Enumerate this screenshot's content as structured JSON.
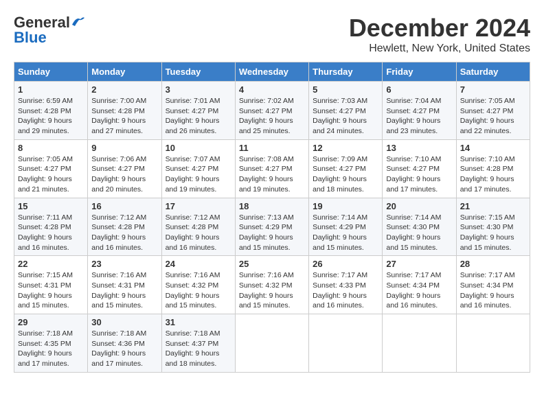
{
  "header": {
    "logo_general": "General",
    "logo_blue": "Blue",
    "month_title": "December 2024",
    "location": "Hewlett, New York, United States"
  },
  "weekdays": [
    "Sunday",
    "Monday",
    "Tuesday",
    "Wednesday",
    "Thursday",
    "Friday",
    "Saturday"
  ],
  "weeks": [
    [
      {
        "day": "1",
        "sunrise": "6:59 AM",
        "sunset": "4:28 PM",
        "daylight": "9 hours and 29 minutes."
      },
      {
        "day": "2",
        "sunrise": "7:00 AM",
        "sunset": "4:28 PM",
        "daylight": "9 hours and 27 minutes."
      },
      {
        "day": "3",
        "sunrise": "7:01 AM",
        "sunset": "4:27 PM",
        "daylight": "9 hours and 26 minutes."
      },
      {
        "day": "4",
        "sunrise": "7:02 AM",
        "sunset": "4:27 PM",
        "daylight": "9 hours and 25 minutes."
      },
      {
        "day": "5",
        "sunrise": "7:03 AM",
        "sunset": "4:27 PM",
        "daylight": "9 hours and 24 minutes."
      },
      {
        "day": "6",
        "sunrise": "7:04 AM",
        "sunset": "4:27 PM",
        "daylight": "9 hours and 23 minutes."
      },
      {
        "day": "7",
        "sunrise": "7:05 AM",
        "sunset": "4:27 PM",
        "daylight": "9 hours and 22 minutes."
      }
    ],
    [
      {
        "day": "8",
        "sunrise": "7:05 AM",
        "sunset": "4:27 PM",
        "daylight": "9 hours and 21 minutes."
      },
      {
        "day": "9",
        "sunrise": "7:06 AM",
        "sunset": "4:27 PM",
        "daylight": "9 hours and 20 minutes."
      },
      {
        "day": "10",
        "sunrise": "7:07 AM",
        "sunset": "4:27 PM",
        "daylight": "9 hours and 19 minutes."
      },
      {
        "day": "11",
        "sunrise": "7:08 AM",
        "sunset": "4:27 PM",
        "daylight": "9 hours and 19 minutes."
      },
      {
        "day": "12",
        "sunrise": "7:09 AM",
        "sunset": "4:27 PM",
        "daylight": "9 hours and 18 minutes."
      },
      {
        "day": "13",
        "sunrise": "7:10 AM",
        "sunset": "4:27 PM",
        "daylight": "9 hours and 17 minutes."
      },
      {
        "day": "14",
        "sunrise": "7:10 AM",
        "sunset": "4:28 PM",
        "daylight": "9 hours and 17 minutes."
      }
    ],
    [
      {
        "day": "15",
        "sunrise": "7:11 AM",
        "sunset": "4:28 PM",
        "daylight": "9 hours and 16 minutes."
      },
      {
        "day": "16",
        "sunrise": "7:12 AM",
        "sunset": "4:28 PM",
        "daylight": "9 hours and 16 minutes."
      },
      {
        "day": "17",
        "sunrise": "7:12 AM",
        "sunset": "4:28 PM",
        "daylight": "9 hours and 16 minutes."
      },
      {
        "day": "18",
        "sunrise": "7:13 AM",
        "sunset": "4:29 PM",
        "daylight": "9 hours and 15 minutes."
      },
      {
        "day": "19",
        "sunrise": "7:14 AM",
        "sunset": "4:29 PM",
        "daylight": "9 hours and 15 minutes."
      },
      {
        "day": "20",
        "sunrise": "7:14 AM",
        "sunset": "4:30 PM",
        "daylight": "9 hours and 15 minutes."
      },
      {
        "day": "21",
        "sunrise": "7:15 AM",
        "sunset": "4:30 PM",
        "daylight": "9 hours and 15 minutes."
      }
    ],
    [
      {
        "day": "22",
        "sunrise": "7:15 AM",
        "sunset": "4:31 PM",
        "daylight": "9 hours and 15 minutes."
      },
      {
        "day": "23",
        "sunrise": "7:16 AM",
        "sunset": "4:31 PM",
        "daylight": "9 hours and 15 minutes."
      },
      {
        "day": "24",
        "sunrise": "7:16 AM",
        "sunset": "4:32 PM",
        "daylight": "9 hours and 15 minutes."
      },
      {
        "day": "25",
        "sunrise": "7:16 AM",
        "sunset": "4:32 PM",
        "daylight": "9 hours and 15 minutes."
      },
      {
        "day": "26",
        "sunrise": "7:17 AM",
        "sunset": "4:33 PM",
        "daylight": "9 hours and 16 minutes."
      },
      {
        "day": "27",
        "sunrise": "7:17 AM",
        "sunset": "4:34 PM",
        "daylight": "9 hours and 16 minutes."
      },
      {
        "day": "28",
        "sunrise": "7:17 AM",
        "sunset": "4:34 PM",
        "daylight": "9 hours and 16 minutes."
      }
    ],
    [
      {
        "day": "29",
        "sunrise": "7:18 AM",
        "sunset": "4:35 PM",
        "daylight": "9 hours and 17 minutes."
      },
      {
        "day": "30",
        "sunrise": "7:18 AM",
        "sunset": "4:36 PM",
        "daylight": "9 hours and 17 minutes."
      },
      {
        "day": "31",
        "sunrise": "7:18 AM",
        "sunset": "4:37 PM",
        "daylight": "9 hours and 18 minutes."
      },
      null,
      null,
      null,
      null
    ]
  ]
}
